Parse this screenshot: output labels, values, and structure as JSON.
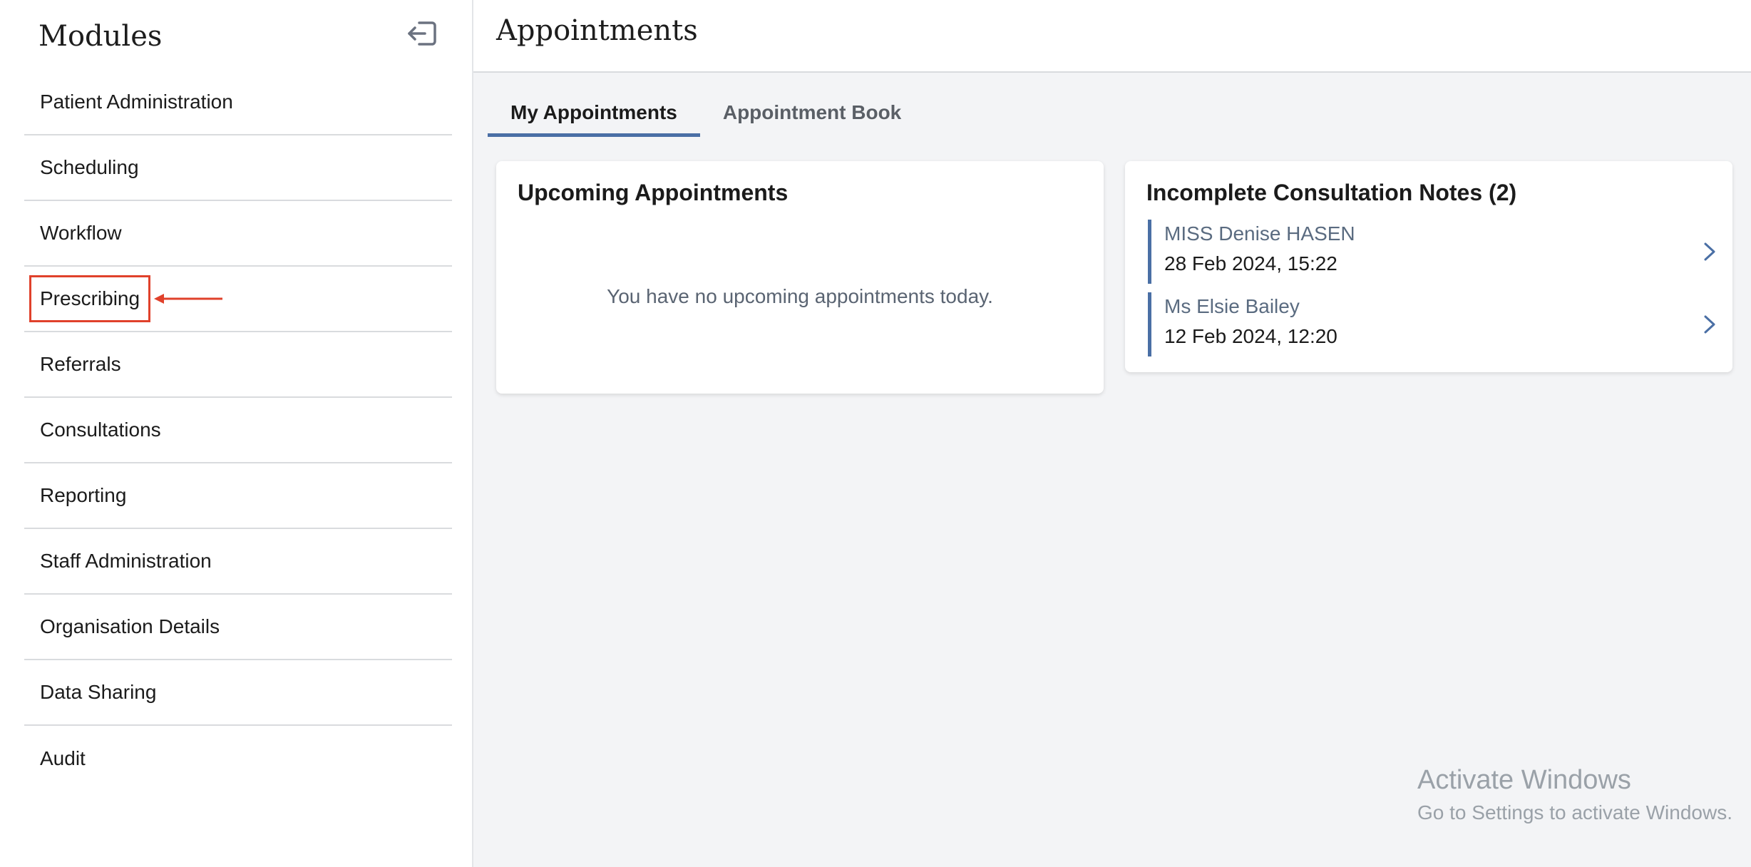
{
  "sidebar": {
    "title": "Modules",
    "collapse_icon": "sign-out-arrow-icon",
    "items": [
      {
        "label": "Patient Administration"
      },
      {
        "label": "Scheduling"
      },
      {
        "label": "Workflow"
      },
      {
        "label": "Prescribing"
      },
      {
        "label": "Referrals"
      },
      {
        "label": "Consultations"
      },
      {
        "label": "Reporting"
      },
      {
        "label": "Staff Administration"
      },
      {
        "label": "Organisation Details"
      },
      {
        "label": "Data Sharing"
      },
      {
        "label": "Audit"
      }
    ],
    "highlight_color": "#e0412b"
  },
  "header": {
    "title": "Appointments"
  },
  "tabs": [
    {
      "label": "My Appointments",
      "active": true
    },
    {
      "label": "Appointment Book",
      "active": false
    }
  ],
  "upcoming": {
    "title": "Upcoming Appointments",
    "empty_message": "You have no upcoming appointments today."
  },
  "incomplete": {
    "title": "Incomplete Consultation Notes (2)",
    "notes": [
      {
        "name": "MISS Denise HASEN",
        "date": "28 Feb 2024, 15:22"
      },
      {
        "name": "Ms Elsie Bailey",
        "date": "12 Feb 2024, 12:20"
      }
    ]
  },
  "watermark": {
    "title": "Activate Windows",
    "subtitle": "Go to Settings to activate Windows."
  },
  "colors": {
    "accent": "#4a6fa5",
    "background": "#f3f4f6"
  }
}
